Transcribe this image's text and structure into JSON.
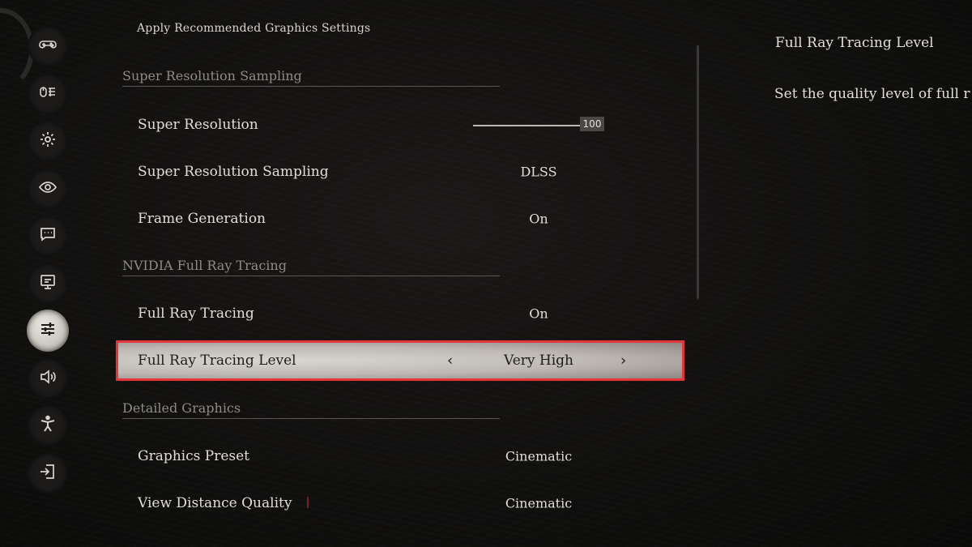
{
  "top_action": "Apply Recommended Graphics Settings",
  "sections": {
    "super_resolution": "Super Resolution Sampling",
    "ray_tracing": "NVIDIA Full Ray Tracing",
    "detailed": "Detailed Graphics"
  },
  "settings": {
    "super_resolution": {
      "label": "Super Resolution",
      "value": "100",
      "fraction": 1.0
    },
    "sampling": {
      "label": "Super Resolution Sampling",
      "value": "DLSS"
    },
    "frame_gen": {
      "label": "Frame Generation",
      "value": "On"
    },
    "full_rt": {
      "label": "Full Ray Tracing",
      "value": "On"
    },
    "full_rt_level": {
      "label": "Full Ray Tracing Level",
      "value": "Very High"
    },
    "preset": {
      "label": "Graphics Preset",
      "value": "Cinematic"
    },
    "view_distance": {
      "label": "View Distance Quality",
      "value": "Cinematic"
    }
  },
  "description": {
    "title": "Full Ray Tracing Level",
    "text": "Set the quality level of full r"
  },
  "sidebar": [
    {
      "icon": "gamepad-icon"
    },
    {
      "icon": "controls-icon"
    },
    {
      "icon": "gear-icon"
    },
    {
      "icon": "eye-icon"
    },
    {
      "icon": "chat-icon"
    },
    {
      "icon": "monitor-icon"
    },
    {
      "icon": "sliders-icon",
      "active": true
    },
    {
      "icon": "speaker-icon"
    },
    {
      "icon": "accessibility-icon"
    },
    {
      "icon": "exit-icon"
    }
  ],
  "colors": {
    "selection_border": "#e5353a",
    "background": "#121110"
  }
}
